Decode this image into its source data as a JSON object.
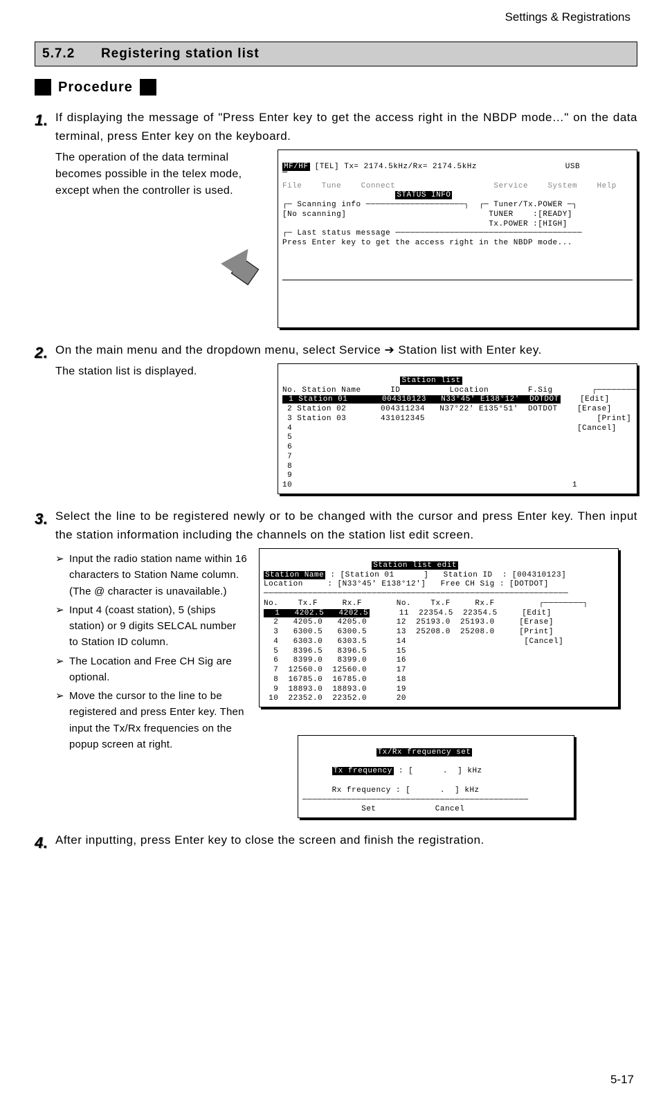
{
  "header": {
    "right": "Settings & Registrations"
  },
  "section": {
    "number": "5.7.2",
    "title": "Registering station list"
  },
  "procedure_label": "Procedure",
  "steps": {
    "s1": {
      "text": "If displaying the message of \"Press Enter key to get the access right in the NBDP mode…\" on the data terminal, press Enter key on the keyboard.",
      "note": "The operation of the data terminal becomes possible in the telex mode, except when the controller is used."
    },
    "s2": {
      "text_a": "On the main menu and the dropdown menu, select Service",
      "text_b": "Station list with Enter key.",
      "note": "The station list is displayed."
    },
    "s3": {
      "text": "Select the line to be registered newly or to be changed with the cursor and press Enter key. Then input the station information including the channels on the station list edit screen.",
      "b1": "Input the radio station name within 16 characters to Station Name column.",
      "b1b": "(The @ character is unavailable.)",
      "b2": "Input 4 (coast station), 5 (ships station) or 9 digits SELCAL number to Station ID column.",
      "b3": "The Location and Free CH Sig are optional.",
      "b4": "Move the cursor to the line to be registered and press Enter key. Then input the Tx/Rx frequencies on the popup screen at right."
    },
    "s4": {
      "text": "After inputting, press Enter key to close the screen and finish the registration."
    }
  },
  "screen1": {
    "top": "[TEL] Tx= 2174.5kHz/Rx= 2174.5kHz                  USB",
    "menu": "File    Tune    Connect                    Service    System    Help",
    "status_title": "STATUS INFO",
    "scan_label": "Scanning info",
    "scan_val": "[No scanning]",
    "tuner_label": "Tuner/Tx.POWER",
    "tuner": "TUNER    :[READY]",
    "txpower": "Tx.POWER :[HIGH]",
    "last_label": "Last status message",
    "last_msg": "Press Enter key to get the access right in the NBDP mode..."
  },
  "screen2": {
    "title": "Station list",
    "header": "No. Station Name      ID          Location        F.Sig",
    "row1": " 1 Station 01       004310123   N33°45' E138°12'  DOTDOT",
    "row2": " 2 Station 02       004311234   N37°22' E135°51'  DOTDOT",
    "row3": " 3 Station 03       431012345",
    "rows_empty": [
      " 4",
      " 5",
      " 6",
      " 7",
      " 8",
      " 9",
      "10"
    ],
    "side": [
      "[Edit]",
      "[Erase]",
      "[Print]",
      "[Cancel]"
    ],
    "corner": "1"
  },
  "screen3": {
    "title": "Station list edit",
    "l1a": "Station Name",
    "l1b": " : [Station 01      ]   Station ID  : [004310123]",
    "l2": "Location     : [N33°45' E138°12']   Free CH Sig : [DOTDOT]",
    "colhead": "No.    Tx.F     Rx.F       No.    Tx.F     Rx.F",
    "left_rows": [
      "  1   4202.5   4202.5",
      "  2   4205.0   4205.0",
      "  3   6300.5   6300.5",
      "  4   6303.0   6303.5",
      "  5   8396.5   8396.5",
      "  6   8399.0   8399.0",
      "  7  12560.0  12560.0",
      "  8  16785.0  16785.0",
      "  9  18893.0  18893.0",
      " 10  22352.0  22352.0"
    ],
    "right_rows": [
      " 11  22354.5  22354.5",
      " 12  25193.0  25193.0",
      " 13  25208.0  25208.0",
      " 14",
      " 15",
      " 16",
      " 17",
      " 18",
      " 19",
      " 20"
    ],
    "side": [
      "[Edit]",
      "[Erase]",
      "[Print]",
      "[Cancel]"
    ]
  },
  "screen4": {
    "title": "Tx/Rx frequency set",
    "tx_label": "Tx frequency",
    "tx_field": " : [      .  ] kHz",
    "rx": "Rx frequency : [      .  ] kHz",
    "set": "Set",
    "cancel": "Cancel"
  },
  "page_num": "5-17",
  "arrow_char": "➔"
}
